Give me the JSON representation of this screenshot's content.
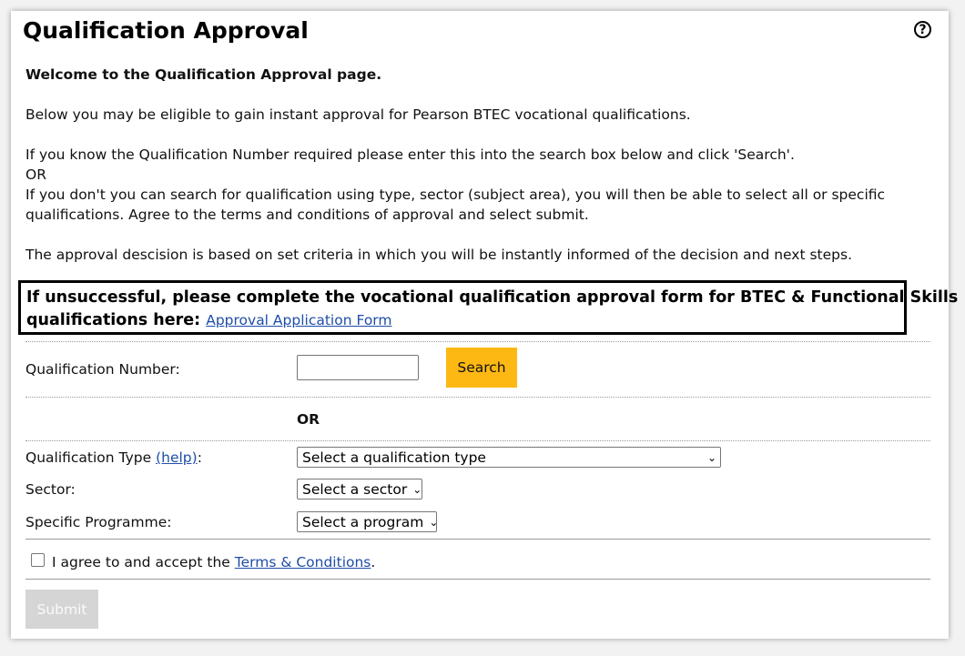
{
  "page": {
    "title": "Qualification Approval",
    "help_icon": "?"
  },
  "intro": {
    "welcome": "Welcome to the Qualification Approval page.",
    "p1": "Below you may be eligible to gain instant approval for Pearson BTEC vocational qualifications.",
    "p2a": "If you know the Qualification Number required please enter this into the search box below and click 'Search'.",
    "p2b": "OR",
    "p2c": "If you don't you can search for qualification using type, sector (subject area), you will then be able to select all or specific",
    "p2d": "qualifications. Agree to the terms and conditions of approval and select submit.",
    "p3": "The approval descision is based on set criteria in which you will be instantly informed of the decision and next steps."
  },
  "notice": {
    "line1": "If unsuccessful, please complete the vocational qualification approval form for BTEC & Functional Skills",
    "line2": "qualifications here:",
    "link": "Approval Application Form"
  },
  "search": {
    "label": "Qualification Number:",
    "value": "",
    "button": "Search"
  },
  "or_label": "OR",
  "filters": {
    "type_label": "Qualification Type",
    "type_help": "(help)",
    "type_colon": ":",
    "type_selected": "Select a qualification type",
    "sector_label": "Sector:",
    "sector_selected": "Select a sector",
    "programme_label": "Specific Programme:",
    "programme_selected": "Select a program"
  },
  "terms": {
    "checked": false,
    "text": "I agree to and accept the",
    "link": "Terms & Conditions",
    "period": "."
  },
  "submit": {
    "label": "Submit",
    "disabled": true
  },
  "colors": {
    "search_button": "#fdb813",
    "link": "#1f4ea8",
    "submit_disabled": "#d5d5d5"
  }
}
